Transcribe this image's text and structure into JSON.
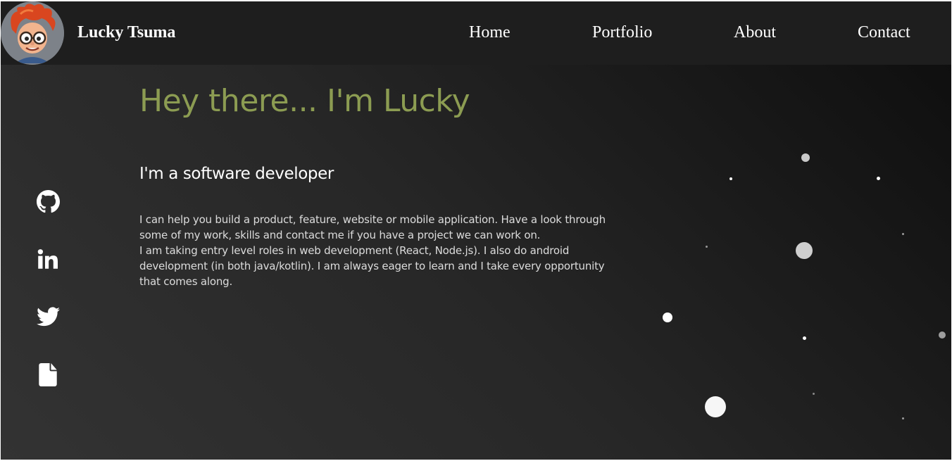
{
  "header": {
    "brand_name": "Lucky Tsuma",
    "nav": [
      {
        "label": "Home"
      },
      {
        "label": "Portfolio"
      },
      {
        "label": "About"
      },
      {
        "label": "Contact"
      }
    ]
  },
  "social_icons": [
    "github-icon",
    "linkedin-icon",
    "twitter-icon",
    "file-icon"
  ],
  "hero": {
    "title": "Hey there... I'm Lucky",
    "subtitle": "I'm a software developer",
    "paragraph_1": "I can help you build a product, feature, website or mobile application. Have a look through some of my work, skills and contact me if you have a project we can work on.",
    "paragraph_2": "I am taking entry level roles in web development (React, Node.js). I also do android development (in both java/kotlin). I am always eager to learn and I take every opportunity that comes along."
  },
  "colors": {
    "accent": "#8c9c52",
    "background_light": "#333333",
    "background_dark": "#0d0d0d",
    "navbar": "#1e1e1e",
    "text": "#ffffff"
  }
}
